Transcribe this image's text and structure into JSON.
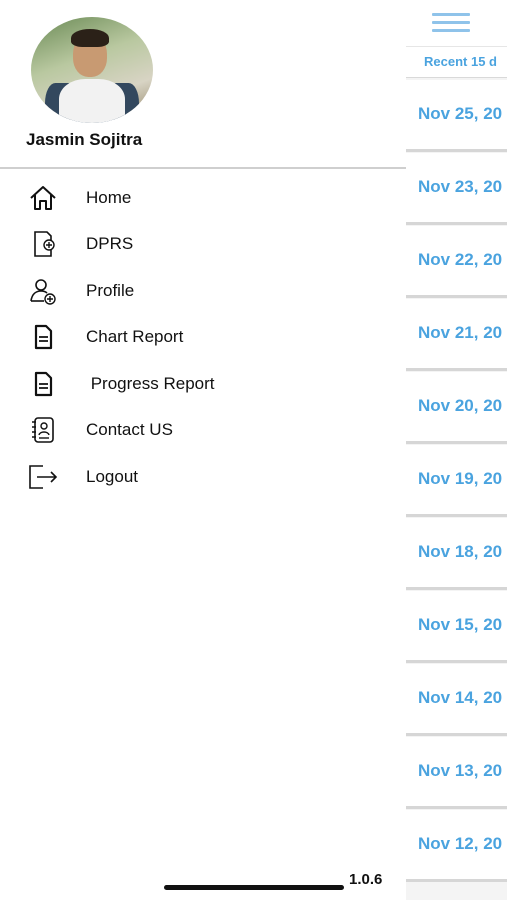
{
  "drawer": {
    "user_name": "Jasmin Sojitra",
    "items": [
      {
        "label": "Home",
        "icon": "home-icon"
      },
      {
        "label": "DPRS",
        "icon": "document-add-icon"
      },
      {
        "label": "Profile",
        "icon": "user-add-icon"
      },
      {
        "label": "Chart Report",
        "icon": "file-text-icon"
      },
      {
        "label": " Progress Report",
        "icon": "file-text-icon"
      },
      {
        "label": "Contact US",
        "icon": "contact-book-icon"
      },
      {
        "label": "Logout",
        "icon": "logout-icon"
      }
    ],
    "version": "1.0.6"
  },
  "background": {
    "subheader": "Recent 15 d",
    "dates": [
      "Nov 25, 20",
      "Nov 23, 20",
      "Nov 22, 20",
      "Nov 21, 20",
      "Nov 20, 20",
      "Nov 19, 20",
      "Nov 18, 20",
      "Nov 15, 20",
      "Nov 14, 20",
      "Nov 13, 20",
      "Nov 12, 20"
    ]
  },
  "colors": {
    "accent": "#4aa3df",
    "menu_icon": "#8fc3ea",
    "text": "#111111"
  }
}
